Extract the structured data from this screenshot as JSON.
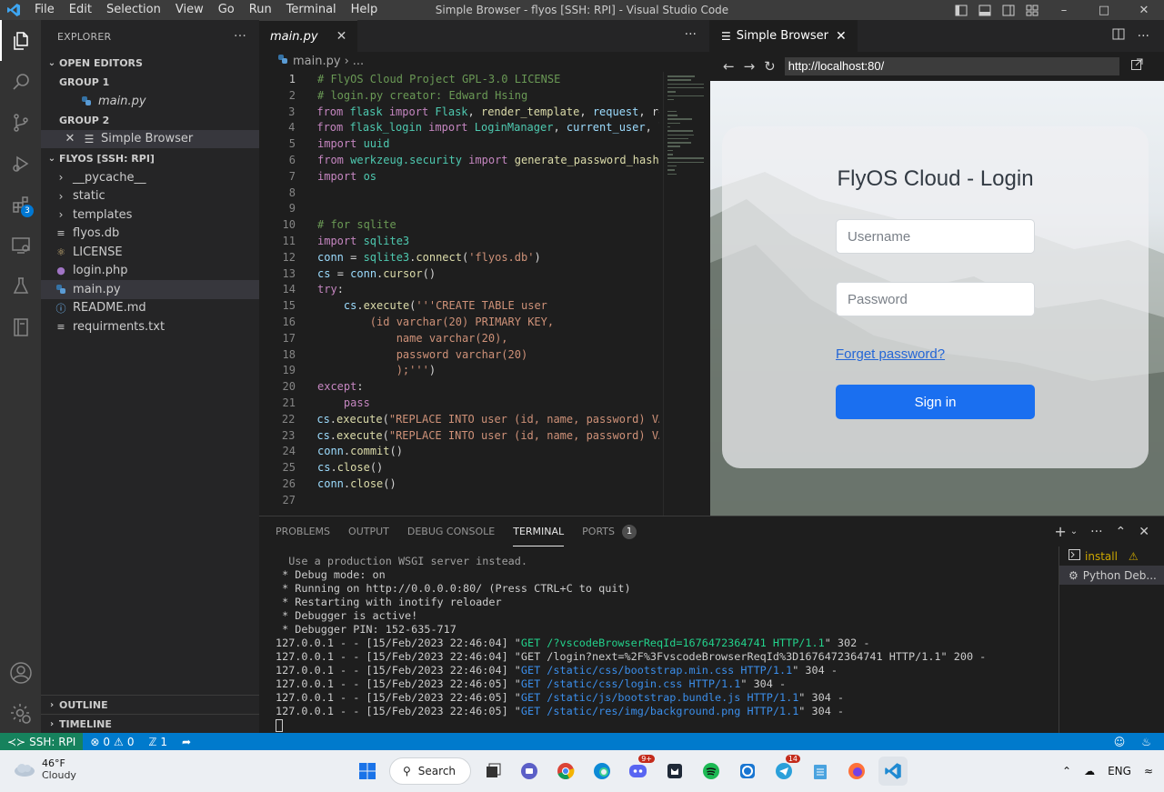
{
  "titlebar": {
    "menu": [
      "File",
      "Edit",
      "Selection",
      "View",
      "Go",
      "Run",
      "Terminal",
      "Help"
    ],
    "title": "Simple Browser - flyos [SSH: RPI] - Visual Studio Code"
  },
  "sidebar": {
    "header": "EXPLORER",
    "open_editors": "OPEN EDITORS",
    "group1": "GROUP 1",
    "group1_file": "main.py",
    "group2": "GROUP 2",
    "group2_file": "Simple Browser",
    "workspace": "FLYOS [SSH: RPI]",
    "files": [
      {
        "name": "__pycache__",
        "type": "folder"
      },
      {
        "name": "static",
        "type": "folder"
      },
      {
        "name": "templates",
        "type": "folder"
      },
      {
        "name": "flyos.db",
        "type": "db"
      },
      {
        "name": "LICENSE",
        "type": "license"
      },
      {
        "name": "login.php",
        "type": "php"
      },
      {
        "name": "main.py",
        "type": "python"
      },
      {
        "name": "README.md",
        "type": "info"
      },
      {
        "name": "requirments.txt",
        "type": "text"
      }
    ],
    "outline": "OUTLINE",
    "timeline": "TIMELINE",
    "extensions_badge": "3"
  },
  "editor": {
    "tab": "main.py",
    "breadcrumb_file": "main.py",
    "breadcrumb_more": "...",
    "lines": [
      [
        [
          "c-com",
          "# FlyOS Cloud Project GPL-3.0 LICENSE"
        ]
      ],
      [
        [
          "c-com",
          "# login.py creator: Edward Hsing"
        ]
      ],
      [
        [
          "c-kw",
          "from "
        ],
        [
          "c-cls",
          "flask "
        ],
        [
          "c-kw",
          "import "
        ],
        [
          "c-cls",
          "Flask"
        ],
        [
          "c-plain",
          ", "
        ],
        [
          "c-fn",
          "render_template"
        ],
        [
          "c-plain",
          ", "
        ],
        [
          "c-var",
          "request"
        ],
        [
          "c-plain",
          ", re"
        ]
      ],
      [
        [
          "c-kw",
          "from "
        ],
        [
          "c-cls",
          "flask_login "
        ],
        [
          "c-kw",
          "import "
        ],
        [
          "c-cls",
          "LoginManager"
        ],
        [
          "c-plain",
          ", "
        ],
        [
          "c-var",
          "current_user"
        ],
        [
          "c-plain",
          ", l"
        ]
      ],
      [
        [
          "c-kw",
          "import "
        ],
        [
          "c-cls",
          "uuid"
        ]
      ],
      [
        [
          "c-kw",
          "from "
        ],
        [
          "c-cls",
          "werkzeug.security "
        ],
        [
          "c-kw",
          "import "
        ],
        [
          "c-fn",
          "generate_password_hash"
        ]
      ],
      [
        [
          "c-kw",
          "import "
        ],
        [
          "c-cls",
          "os"
        ]
      ],
      [],
      [],
      [
        [
          "c-com",
          "# for sqlite"
        ]
      ],
      [
        [
          "c-kw",
          "import "
        ],
        [
          "c-cls",
          "sqlite3"
        ]
      ],
      [
        [
          "c-var",
          "conn "
        ],
        [
          "c-plain",
          "= "
        ],
        [
          "c-cls",
          "sqlite3"
        ],
        [
          "c-plain",
          "."
        ],
        [
          "c-fn",
          "connect"
        ],
        [
          "c-plain",
          "("
        ],
        [
          "c-str",
          "'flyos.db'"
        ],
        [
          "c-plain",
          ")"
        ]
      ],
      [
        [
          "c-var",
          "cs "
        ],
        [
          "c-plain",
          "= "
        ],
        [
          "c-var",
          "conn"
        ],
        [
          "c-plain",
          "."
        ],
        [
          "c-fn",
          "cursor"
        ],
        [
          "c-plain",
          "()"
        ]
      ],
      [
        [
          "c-kw",
          "try"
        ],
        [
          "c-plain",
          ":"
        ]
      ],
      [
        [
          "c-plain",
          "    "
        ],
        [
          "c-var",
          "cs"
        ],
        [
          "c-plain",
          "."
        ],
        [
          "c-fn",
          "execute"
        ],
        [
          "c-plain",
          "("
        ],
        [
          "c-str",
          "'''CREATE TABLE user"
        ]
      ],
      [
        [
          "c-str",
          "        (id varchar(20) PRIMARY KEY,"
        ]
      ],
      [
        [
          "c-str",
          "            name varchar(20),"
        ]
      ],
      [
        [
          "c-str",
          "            password varchar(20)"
        ]
      ],
      [
        [
          "c-str",
          "            );'''"
        ],
        [
          "c-plain",
          ")"
        ]
      ],
      [
        [
          "c-kw",
          "except"
        ],
        [
          "c-plain",
          ":"
        ]
      ],
      [
        [
          "c-plain",
          "    "
        ],
        [
          "c-kw",
          "pass"
        ]
      ],
      [
        [
          "c-var",
          "cs"
        ],
        [
          "c-plain",
          "."
        ],
        [
          "c-fn",
          "execute"
        ],
        [
          "c-plain",
          "("
        ],
        [
          "c-str",
          "\"REPLACE INTO user (id, name, password) VA"
        ]
      ],
      [
        [
          "c-var",
          "cs"
        ],
        [
          "c-plain",
          "."
        ],
        [
          "c-fn",
          "execute"
        ],
        [
          "c-plain",
          "("
        ],
        [
          "c-str",
          "\"REPLACE INTO user (id, name, password) VA"
        ]
      ],
      [
        [
          "c-var",
          "conn"
        ],
        [
          "c-plain",
          "."
        ],
        [
          "c-fn",
          "commit"
        ],
        [
          "c-plain",
          "()"
        ]
      ],
      [
        [
          "c-var",
          "cs"
        ],
        [
          "c-plain",
          "."
        ],
        [
          "c-fn",
          "close"
        ],
        [
          "c-plain",
          "()"
        ]
      ],
      [
        [
          "c-var",
          "conn"
        ],
        [
          "c-plain",
          "."
        ],
        [
          "c-fn",
          "close"
        ],
        [
          "c-plain",
          "()"
        ]
      ],
      []
    ],
    "current_line": 1
  },
  "browser": {
    "tab": "Simple Browser",
    "url": "http://localhost:80/",
    "login_title": "FlyOS Cloud - Login",
    "username_placeholder": "Username",
    "password_placeholder": "Password",
    "forgot": "Forget password?",
    "signin": "Sign in"
  },
  "panel": {
    "tabs": [
      "PROBLEMS",
      "OUTPUT",
      "DEBUG CONSOLE",
      "TERMINAL",
      "PORTS"
    ],
    "active_tab": "TERMINAL",
    "ports_badge": "1",
    "terminal_lines": [
      {
        "dim": true,
        "parts": [
          [
            "",
            "  Use a production WSGI server instead."
          ]
        ]
      },
      {
        "parts": [
          [
            "",
            " * Debug mode: on"
          ]
        ]
      },
      {
        "parts": [
          [
            "",
            " * Running on http://0.0.0.0:80/ (Press CTRL+C to quit)"
          ]
        ]
      },
      {
        "parts": [
          [
            "",
            " * Restarting with inotify reloader"
          ]
        ]
      },
      {
        "parts": [
          [
            "",
            " * Debugger is active!"
          ]
        ]
      },
      {
        "parts": [
          [
            "",
            " * Debugger PIN: 152-635-717"
          ]
        ]
      },
      {
        "parts": [
          [
            "",
            "127.0.0.1 - - [15/Feb/2023 22:46:04] \""
          ],
          [
            "hl",
            "GET /?vscodeBrowserReqId=1676472364741 HTTP/1.1"
          ],
          [
            "",
            "\" 302 -"
          ]
        ]
      },
      {
        "parts": [
          [
            "",
            "127.0.0.1 - - [15/Feb/2023 22:46:04] \"GET /login?next=%2F%3FvscodeBrowserReqId%3D1676472364741 HTTP/1.1\" 200 -"
          ]
        ]
      },
      {
        "parts": [
          [
            "",
            "127.0.0.1 - - [15/Feb/2023 22:46:04] \""
          ],
          [
            "bl",
            "GET /static/css/bootstrap.min.css HTTP/1.1"
          ],
          [
            "",
            "\" 304 -"
          ]
        ]
      },
      {
        "parts": [
          [
            "",
            "127.0.0.1 - - [15/Feb/2023 22:46:05] \""
          ],
          [
            "bl",
            "GET /static/css/login.css HTTP/1.1"
          ],
          [
            "",
            "\" 304 -"
          ]
        ]
      },
      {
        "parts": [
          [
            "",
            "127.0.0.1 - - [15/Feb/2023 22:46:05] \""
          ],
          [
            "bl",
            "GET /static/js/bootstrap.bundle.js HTTP/1.1"
          ],
          [
            "",
            "\" 304 -"
          ]
        ]
      },
      {
        "parts": [
          [
            "",
            "127.0.0.1 - - [15/Feb/2023 22:46:05] \""
          ],
          [
            "bl",
            "GET /static/res/img/background.png HTTP/1.1"
          ],
          [
            "",
            "\" 304 -"
          ]
        ]
      }
    ],
    "terminal_list": [
      "install",
      "Python Deb..."
    ]
  },
  "status": {
    "remote": "SSH: RPI",
    "errors": "0",
    "warnings": "0",
    "ports": "1"
  },
  "taskbar": {
    "temp": "46°F",
    "weather": "Cloudy",
    "search": "Search",
    "lang": "ENG",
    "discord_badge": "9+",
    "telegram_badge": "14"
  },
  "colors": {
    "accent": "#007acc",
    "remote": "#16825d",
    "signin": "#1a6ff0"
  }
}
